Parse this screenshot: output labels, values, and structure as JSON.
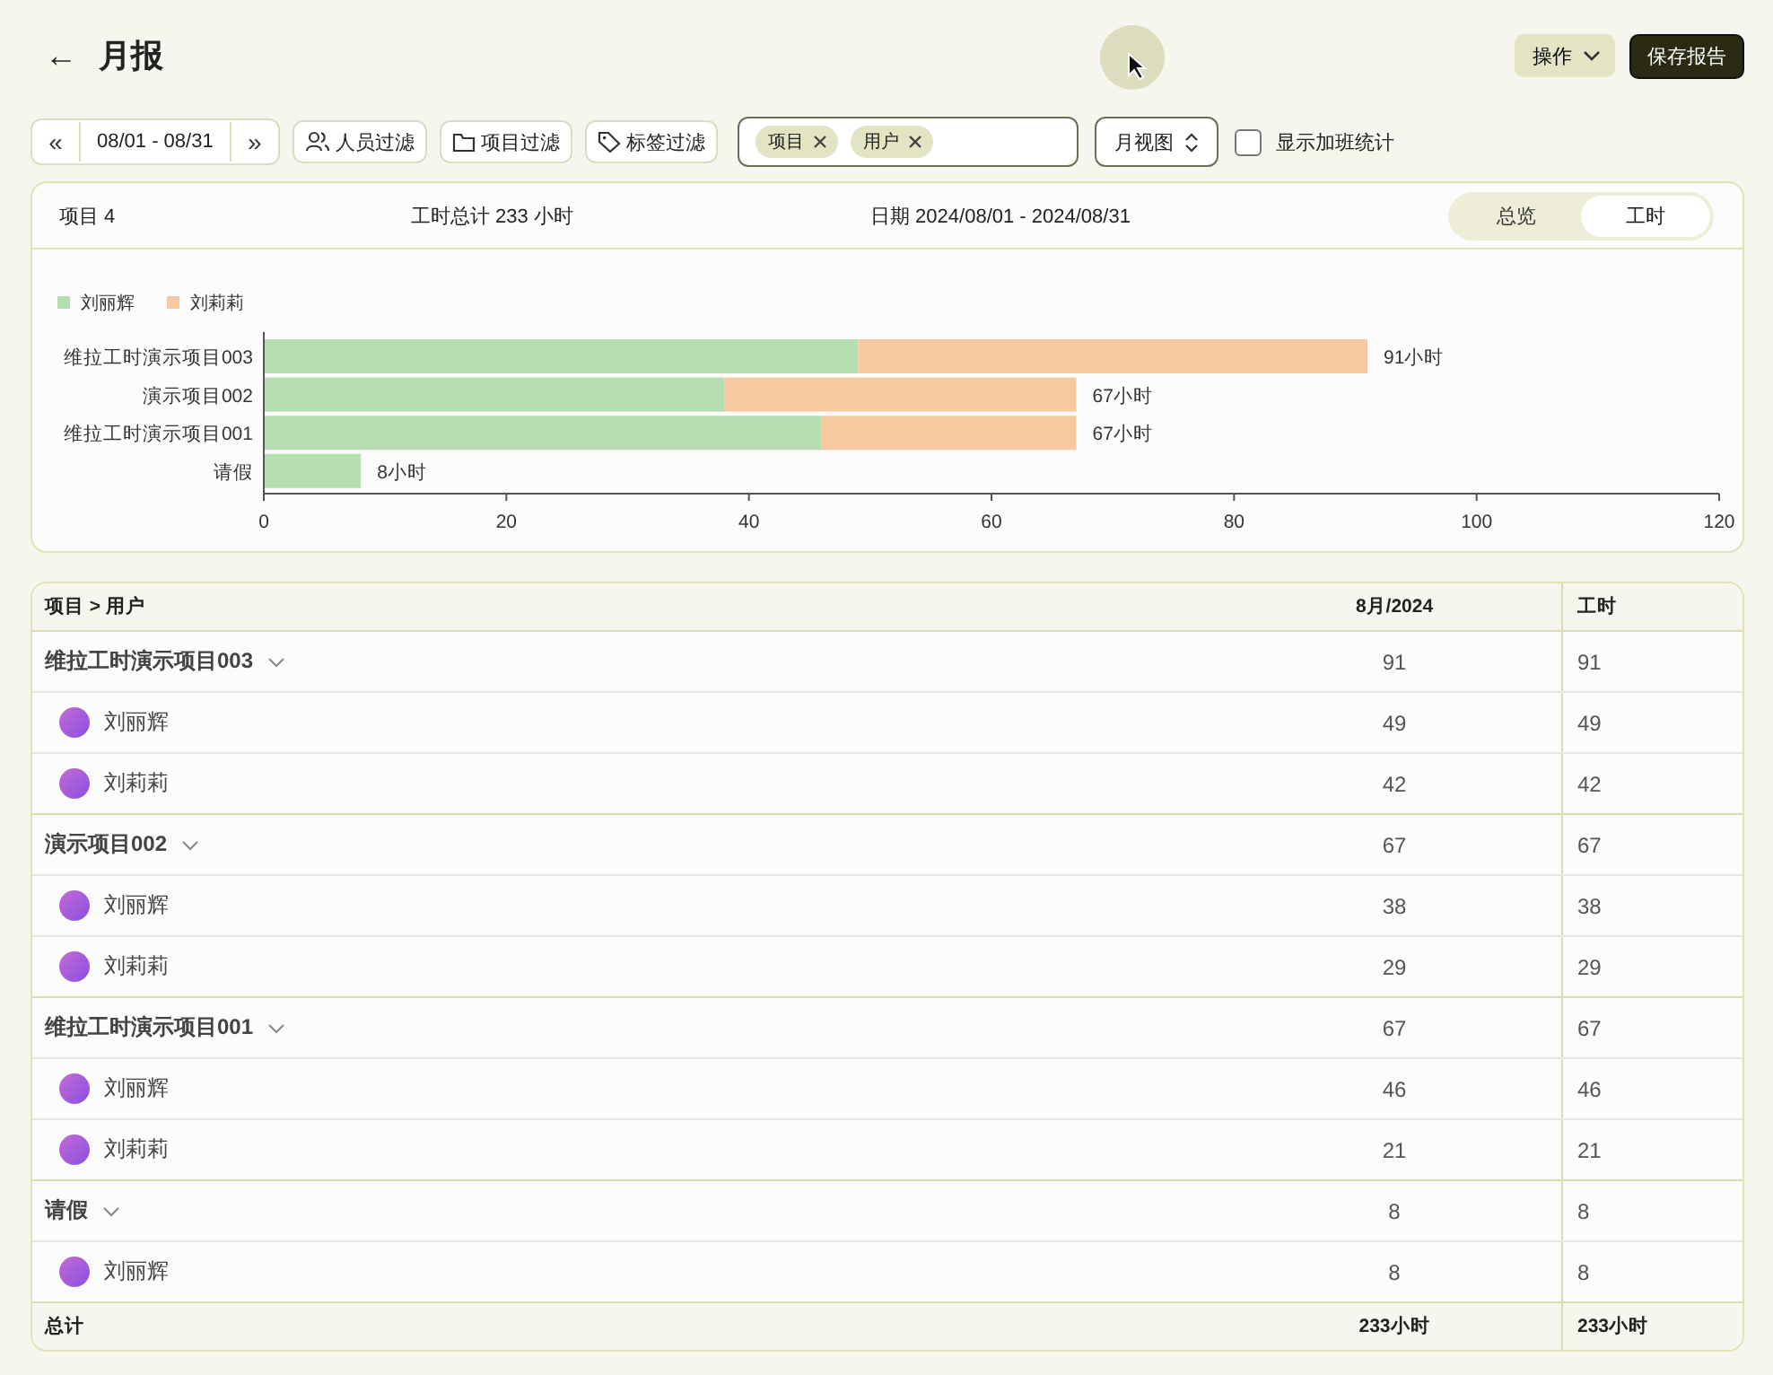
{
  "header": {
    "back": "←",
    "title": "月报",
    "actions_button": "操作",
    "save_button": "保存报告"
  },
  "toolbar": {
    "prev": "«",
    "date_range": "08/01 - 08/31",
    "next": "»",
    "filters": [
      "人员过滤",
      "项目过滤",
      "标签过滤"
    ],
    "group_tags": [
      {
        "label": "项目"
      },
      {
        "label": "用户"
      }
    ],
    "view_select": "月视图",
    "overtime": {
      "label": "显示加班统计",
      "checked": false
    }
  },
  "summary": {
    "projects": "项目 4",
    "total": "工时总计 233 小时",
    "dates": "日期 2024/08/01 - 2024/08/31",
    "tabs": [
      {
        "label": "总览",
        "selected": false
      },
      {
        "label": "工时",
        "selected": true
      }
    ],
    "chart_data": {
      "type": "bar",
      "orientation": "horizontal",
      "stacked": true,
      "categories": [
        "维拉工时演示项目003",
        "演示项目002",
        "维拉工时演示项目001",
        "请假"
      ],
      "series": [
        {
          "name": "刘丽辉",
          "color": "#b5dfb0",
          "values": [
            49,
            38,
            46,
            8
          ]
        },
        {
          "name": "刘莉莉",
          "color": "#f8c9a0",
          "values": [
            42,
            29,
            21,
            null
          ]
        }
      ],
      "xlim": [
        0,
        120
      ],
      "xticks": [
        0,
        20,
        40,
        60,
        80,
        100,
        120
      ],
      "value_labels": [
        "91小时",
        "67小时",
        "67小时",
        "8小时"
      ]
    }
  },
  "table": {
    "columns": [
      "项目 > 用户",
      "8月/2024",
      "工时"
    ],
    "groups": [
      {
        "name": "维拉工时演示项目003",
        "month": "91",
        "total": "91",
        "children": [
          {
            "name": "刘丽辉",
            "month": "49",
            "total": "49"
          },
          {
            "name": "刘莉莉",
            "month": "42",
            "total": "42"
          }
        ]
      },
      {
        "name": "演示项目002",
        "month": "67",
        "total": "67",
        "children": [
          {
            "name": "刘丽辉",
            "month": "38",
            "total": "38"
          },
          {
            "name": "刘莉莉",
            "month": "29",
            "total": "29"
          }
        ]
      },
      {
        "name": "维拉工时演示项目001",
        "month": "67",
        "total": "67",
        "children": [
          {
            "name": "刘丽辉",
            "month": "46",
            "total": "46"
          },
          {
            "name": "刘莉莉",
            "month": "21",
            "total": "21"
          }
        ]
      },
      {
        "name": "请假",
        "month": "8",
        "total": "8",
        "children": [
          {
            "name": "刘丽辉",
            "month": "8",
            "total": "8"
          }
        ]
      }
    ],
    "footer": {
      "label": "总计",
      "month": "233小时",
      "total": "233小时"
    }
  }
}
